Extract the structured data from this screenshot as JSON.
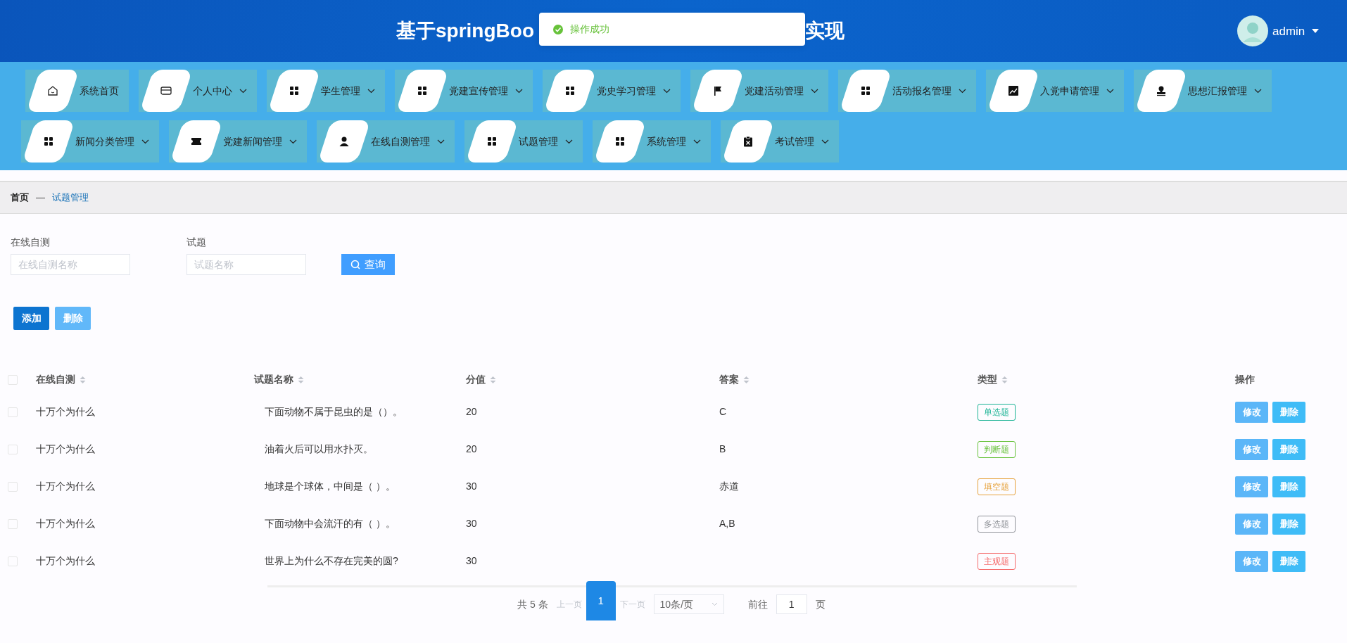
{
  "header": {
    "title_start": "基于springBoo",
    "title_end": "实现",
    "user": "admin"
  },
  "toast": {
    "message": "操作成功"
  },
  "nav": {
    "rows": [
      {
        "items": [
          {
            "label": "系统首页",
            "has_menu": false
          },
          {
            "label": "个人中心",
            "has_menu": true
          },
          {
            "label": "学生管理",
            "has_menu": true
          },
          {
            "label": "党建宣传管理",
            "has_menu": true
          },
          {
            "label": "党史学习管理",
            "has_menu": true
          },
          {
            "label": "党建活动管理",
            "has_menu": true
          },
          {
            "label": "活动报名管理",
            "has_menu": true
          },
          {
            "label": "入党申请管理",
            "has_menu": true
          },
          {
            "label": "思想汇报管理",
            "has_menu": true
          }
        ]
      },
      {
        "items": [
          {
            "label": "新闻分类管理",
            "has_menu": true
          },
          {
            "label": "党建新闻管理",
            "has_menu": true
          },
          {
            "label": "在线自测管理",
            "has_menu": true
          },
          {
            "label": "试题管理",
            "has_menu": true
          },
          {
            "label": "系统管理",
            "has_menu": true
          },
          {
            "label": "考试管理",
            "has_menu": true
          }
        ]
      }
    ]
  },
  "breadcrumb": {
    "items": [
      {
        "label": "首页",
        "current": false
      },
      {
        "label": "试题管理",
        "current": true
      }
    ],
    "separator": "—"
  },
  "search": {
    "fields": [
      {
        "label": "在线自测",
        "placeholder": "在线自测名称"
      },
      {
        "label": "试题",
        "placeholder": "试题名称"
      }
    ],
    "button": "查询"
  },
  "actions": [
    {
      "label": "添加",
      "disabled": false
    },
    {
      "label": "删除",
      "disabled": true
    }
  ],
  "table": {
    "all_checked": false,
    "columns": [
      {
        "label": "在线自测",
        "sortable": true
      },
      {
        "label": "试题名称",
        "sortable": true
      },
      {
        "label": "分值",
        "sortable": true
      },
      {
        "label": "答案",
        "sortable": true
      },
      {
        "label": "类型",
        "sortable": true
      },
      {
        "label": "操作",
        "sortable": false
      }
    ],
    "rows": [
      {
        "checked": false,
        "test": "十万个为什么",
        "question": "下面动物不属于昆虫的是（）。",
        "score": "20",
        "answer": "C",
        "type": {
          "label": "单选题",
          "color": "#1ab394"
        },
        "buttons": [
          "修改",
          "删除"
        ]
      },
      {
        "checked": false,
        "test": "十万个为什么",
        "question": "油着火后可以用水扑灭。",
        "score": "20",
        "answer": "B",
        "type": {
          "label": "判断题",
          "color": "#67c23a"
        },
        "buttons": [
          "修改",
          "删除"
        ]
      },
      {
        "checked": false,
        "test": "十万个为什么",
        "question": "地球是个球体，中间是（ ）。",
        "score": "30",
        "answer": "赤道",
        "type": {
          "label": "填空题",
          "color": "#e6a23c"
        },
        "buttons": [
          "修改",
          "删除"
        ]
      },
      {
        "checked": false,
        "test": "十万个为什么",
        "question": "下面动物中会流汗的有（ ）。",
        "score": "30",
        "answer": "A,B",
        "type": {
          "label": "多选题",
          "color": "#909399"
        },
        "buttons": [
          "修改",
          "删除"
        ]
      },
      {
        "checked": false,
        "test": "十万个为什么",
        "question": "世界上为什么不存在完美的圆?",
        "score": "30",
        "type": {
          "label": "主观题",
          "color": "#f56c6c"
        },
        "buttons": [
          "修改",
          "删除"
        ]
      }
    ]
  },
  "pagination": {
    "total": "共 5 条",
    "prev": "上一页",
    "pages": [
      {
        "label": "1",
        "selected": true
      }
    ],
    "next": "下一页",
    "page_size": "10条/页",
    "goto": "前往",
    "goto_value": "1",
    "page_unit": "页"
  }
}
